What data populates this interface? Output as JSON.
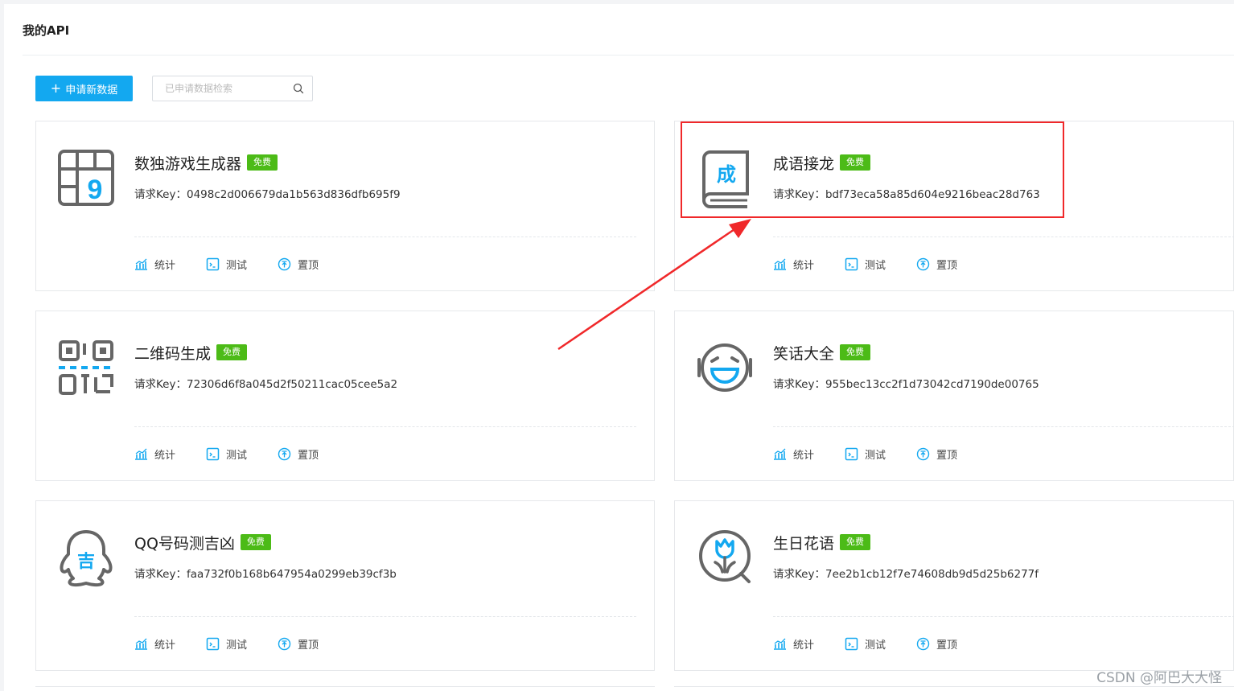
{
  "page": {
    "title": "我的API",
    "apply_button": "申请新数据",
    "search_placeholder": "已申请数据检索",
    "watermark": "CSDN @阿巴大大怪"
  },
  "labels": {
    "key_prefix": "请求Key：",
    "free_badge": "免费",
    "stats": "统计",
    "test": "测试",
    "pin": "置顶"
  },
  "colors": {
    "primary": "#13a8f0",
    "badge": "#4cbb17",
    "highlight": "#f0282a"
  },
  "cards": [
    {
      "name": "数独游戏生成器",
      "key": "0498c2d006679da1b563d836dfb695f9",
      "icon": "sudoku-icon"
    },
    {
      "name": "成语接龙",
      "key": "bdf73eca58a85d604e9216beac28d763",
      "icon": "idiom-book-icon"
    },
    {
      "name": "二维码生成",
      "key": "72306d6f8a045d2f50211cac05cee5a2",
      "icon": "qr-code-icon"
    },
    {
      "name": "笑话大全",
      "key": "955bec13cc2f1d73042cd7190de00765",
      "icon": "laughing-face-icon"
    },
    {
      "name": "QQ号码测吉凶",
      "key": "faa732f0b168b647954a0299eb39cf3b",
      "icon": "qq-fortune-icon"
    },
    {
      "name": "生日花语",
      "key": "7ee2b1cb12f7e74608db9d5d25b6277f",
      "icon": "birthday-flower-icon"
    }
  ]
}
